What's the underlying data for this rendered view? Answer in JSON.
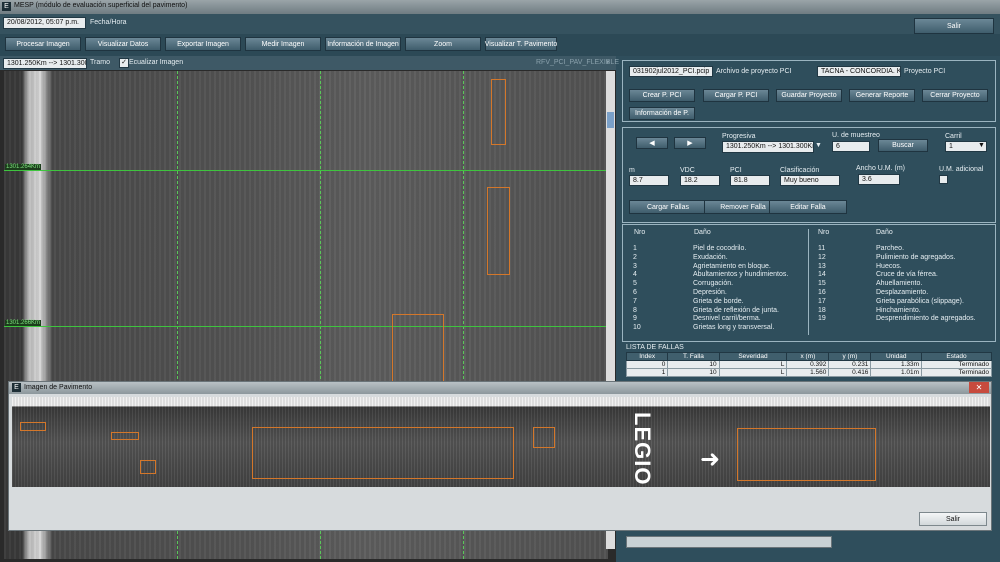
{
  "window": {
    "title": "MESP (módulo de evaluación superficial del pavimento)"
  },
  "header": {
    "date_value": "20/08/2012, 05:07 p.m.",
    "date_label": "Fecha/Hora",
    "exit_label": "Salir"
  },
  "toolbar": {
    "buttons": [
      "Procesar Imagen",
      "Visualizar Datos",
      "Exportar Imagen",
      "Medir Imagen",
      "Información de Imagen",
      "Zoom",
      "Visualizar T. Pavimento"
    ]
  },
  "left": {
    "tramo_value": "1301.250Km --> 1301.300Km",
    "tramo_label": "Tramo",
    "equalize_label": "Ecualizar Imagen",
    "layer_select": "RFV_PCI_PAV_FLEXIBLE",
    "marker_1": "1301.264Km",
    "marker_2": "1301.266Km"
  },
  "project": {
    "file_value": "031902jul2012_PCI.pcip",
    "file_label": "Archivo de proyecto PCI",
    "project_value": "TACNA - CONCORDIA. KM.",
    "project_label": "Proyecto PCI",
    "buttons": [
      "Crear P. PCI",
      "Cargar P. PCI",
      "Guardar Proyecto",
      "Generar Reporte",
      "Cerrar Proyecto",
      "Información de P."
    ]
  },
  "nav": {
    "progresiva_label": "Progresiva",
    "progresiva_value": "1301.250Km --> 1301.300Km",
    "muestreo_label": "U. de muestreo",
    "muestreo_value": "6",
    "buscar_label": "Buscar",
    "carril_label": "Carril",
    "carril_value": "1"
  },
  "metrics": {
    "m_label": "m",
    "m_value": "8.7",
    "vdc_label": "VDC",
    "vdc_value": "18.2",
    "pci_label": "PCI",
    "pci_value": "81.8",
    "clasif_label": "Clasificación",
    "clasif_value": "Muy bueno",
    "ancho_label": "Ancho U.M. (m)",
    "ancho_value": "3.6",
    "adicional_label": "U.M. adicional"
  },
  "fallas_buttons": [
    "Cargar Fallas",
    "Remover Falla",
    "Editar Falla"
  ],
  "damage_legend": {
    "col_nro": "Nro",
    "col_dano": "Daño",
    "left": [
      [
        "1",
        "Piel de cocodrilo."
      ],
      [
        "2",
        "Exudación."
      ],
      [
        "3",
        "Agrietamiento en bloque."
      ],
      [
        "4",
        "Abultamientos y hundimientos."
      ],
      [
        "5",
        "Corrugación."
      ],
      [
        "6",
        "Depresión."
      ],
      [
        "7",
        "Grieta de borde."
      ],
      [
        "8",
        "Grieta de reflexión de junta."
      ],
      [
        "9",
        "Desnivel carril/berma."
      ],
      [
        "10",
        "Grietas long y transversal."
      ]
    ],
    "right": [
      [
        "11",
        "Parcheo."
      ],
      [
        "12",
        "Pulimiento de agregados."
      ],
      [
        "13",
        "Huecos."
      ],
      [
        "14",
        "Cruce de vía férrea."
      ],
      [
        "15",
        "Ahuellamiento."
      ],
      [
        "16",
        "Desplazamiento."
      ],
      [
        "17",
        "Grieta parabólica (slippage)."
      ],
      [
        "18",
        "Hinchamiento."
      ],
      [
        "19",
        "Desprendimiento de agregados."
      ]
    ]
  },
  "fallas_list": {
    "title": "LISTA DE FALLAS",
    "headers": [
      "Index",
      "T. Falla",
      "Severidad",
      "x (m)",
      "y (m)",
      "Unidad",
      "Estado"
    ],
    "rows": [
      [
        "0",
        "10",
        "L",
        "0.392",
        "0.231",
        "1.33m",
        "Terminado"
      ],
      [
        "1",
        "10",
        "L",
        "1.560",
        "0.416",
        "1.01m",
        "Terminado"
      ]
    ]
  },
  "dialog": {
    "title": "Imagen de Pavimento",
    "exit_label": "Salir",
    "road_text": "LEGIO"
  },
  "colors": {
    "background": "#2f4e5c",
    "accent": "#d4772a",
    "marker": "#3ec43e"
  }
}
